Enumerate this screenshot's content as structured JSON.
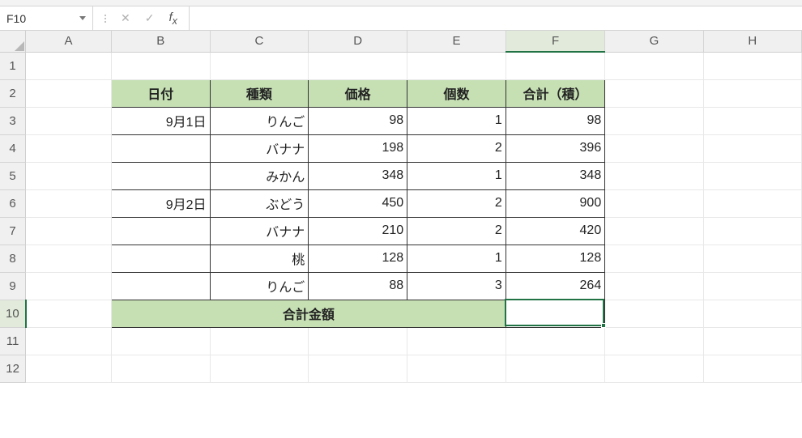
{
  "name_box": "F10",
  "formula_input": "",
  "columns": [
    "A",
    "B",
    "C",
    "D",
    "E",
    "F",
    "G",
    "H"
  ],
  "rows": [
    "1",
    "2",
    "3",
    "4",
    "5",
    "6",
    "7",
    "8",
    "9",
    "10",
    "11",
    "12"
  ],
  "headers": {
    "b": "日付",
    "c": "種類",
    "d": "価格",
    "e": "個数",
    "f": "合計（積）"
  },
  "data": [
    {
      "b": "9月1日",
      "c": "りんご",
      "d": "98",
      "e": "1",
      "f": "98"
    },
    {
      "b": "",
      "c": "バナナ",
      "d": "198",
      "e": "2",
      "f": "396"
    },
    {
      "b": "",
      "c": "みかん",
      "d": "348",
      "e": "1",
      "f": "348"
    },
    {
      "b": "9月2日",
      "c": "ぶどう",
      "d": "450",
      "e": "2",
      "f": "900"
    },
    {
      "b": "",
      "c": "バナナ",
      "d": "210",
      "e": "2",
      "f": "420"
    },
    {
      "b": "",
      "c": "桃",
      "d": "128",
      "e": "1",
      "f": "128"
    },
    {
      "b": "",
      "c": "りんご",
      "d": "88",
      "e": "3",
      "f": "264"
    }
  ],
  "total_label": "合計金額",
  "total_value": ""
}
